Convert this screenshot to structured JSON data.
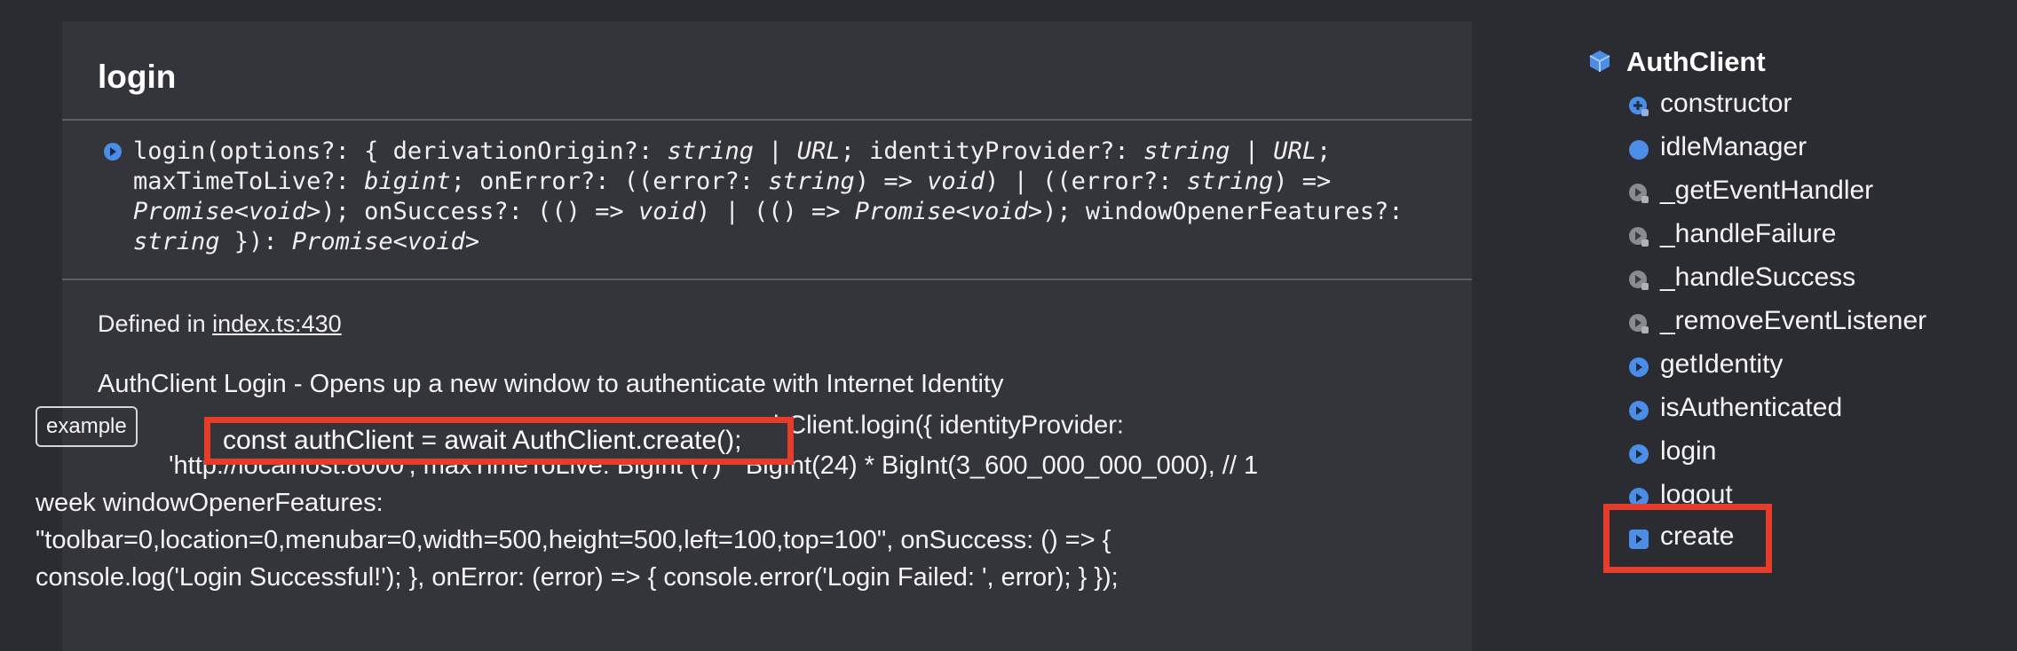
{
  "panel": {
    "title": "login",
    "signature": {
      "icon": "method-icon",
      "line1": "login(options?: { derivationOrigin?: ",
      "line1_t1": "string",
      "line1_sep1": " | ",
      "line1_t2": "URL",
      "line1_b": "; identityProvider?: ",
      "line1_t3": "string",
      "line1_sep2": " | ",
      "line1_t4": "URL",
      "line1_end": ";",
      "line2_a": "maxTimeToLive?: ",
      "line2_t1": "bigint",
      "line2_b": "; onError?: ((error?: ",
      "line2_t2": "string",
      "line2_c": ") => ",
      "line2_t3": "void",
      "line2_d": ") | ((error?: ",
      "line2_t4": "string",
      "line2_e": ") =>",
      "line3_t1": "Promise<void>",
      "line3_a": "); onSuccess?: (() => ",
      "line3_t2": "void",
      "line3_b": ") | (() => ",
      "line3_t3": "Promise<void>",
      "line3_c": "); windowOpenerFeatures?:",
      "line4_t1": "string",
      "line4_a": " }): ",
      "line4_t2": "Promise<void>"
    },
    "defined_prefix": "Defined in ",
    "defined_link": "index.ts:430",
    "description": "AuthClient Login - Opens up a new window to authenticate with Internet Identity",
    "example_tag": "example",
    "highlight_code": "const authClient = await AuthClient.create();",
    "example_line1_rest": "authClient.login({ identityProvider:",
    "example_line2": "'http://localhost:8000', maxTimeToLive: BigInt (7) * BigInt(24) * BigInt(3_600_000_000_000), // 1",
    "example_line3": "week windowOpenerFeatures:",
    "example_line4": "\"toolbar=0,location=0,menubar=0,width=500,height=500,left=100,top=100\", onSuccess: () => {",
    "example_line5": "console.log('Login Successful!'); }, onError: (error) => { console.error('Login Failed: ', error); } });"
  },
  "sidebar": {
    "heading": "AuthClient",
    "heading_icon": "class-icon",
    "items": [
      {
        "label": "constructor",
        "icon": "constructor-icon"
      },
      {
        "label": "idleManager",
        "icon": "property-icon"
      },
      {
        "label": "_getEventHandler",
        "icon": "private-method-icon"
      },
      {
        "label": "_handleFailure",
        "icon": "private-method-icon"
      },
      {
        "label": "_handleSuccess",
        "icon": "private-method-icon"
      },
      {
        "label": "_removeEventListener",
        "icon": "private-method-icon"
      },
      {
        "label": "getIdentity",
        "icon": "method-icon"
      },
      {
        "label": "isAuthenticated",
        "icon": "method-icon"
      },
      {
        "label": "login",
        "icon": "method-icon"
      },
      {
        "label": "logout",
        "icon": "method-icon"
      },
      {
        "label": "create",
        "icon": "static-method-icon"
      }
    ]
  },
  "colors": {
    "background": "#2b2c31",
    "panel": "#34353b",
    "highlight": "#e83c2b",
    "accent": "#4a8ee8"
  }
}
